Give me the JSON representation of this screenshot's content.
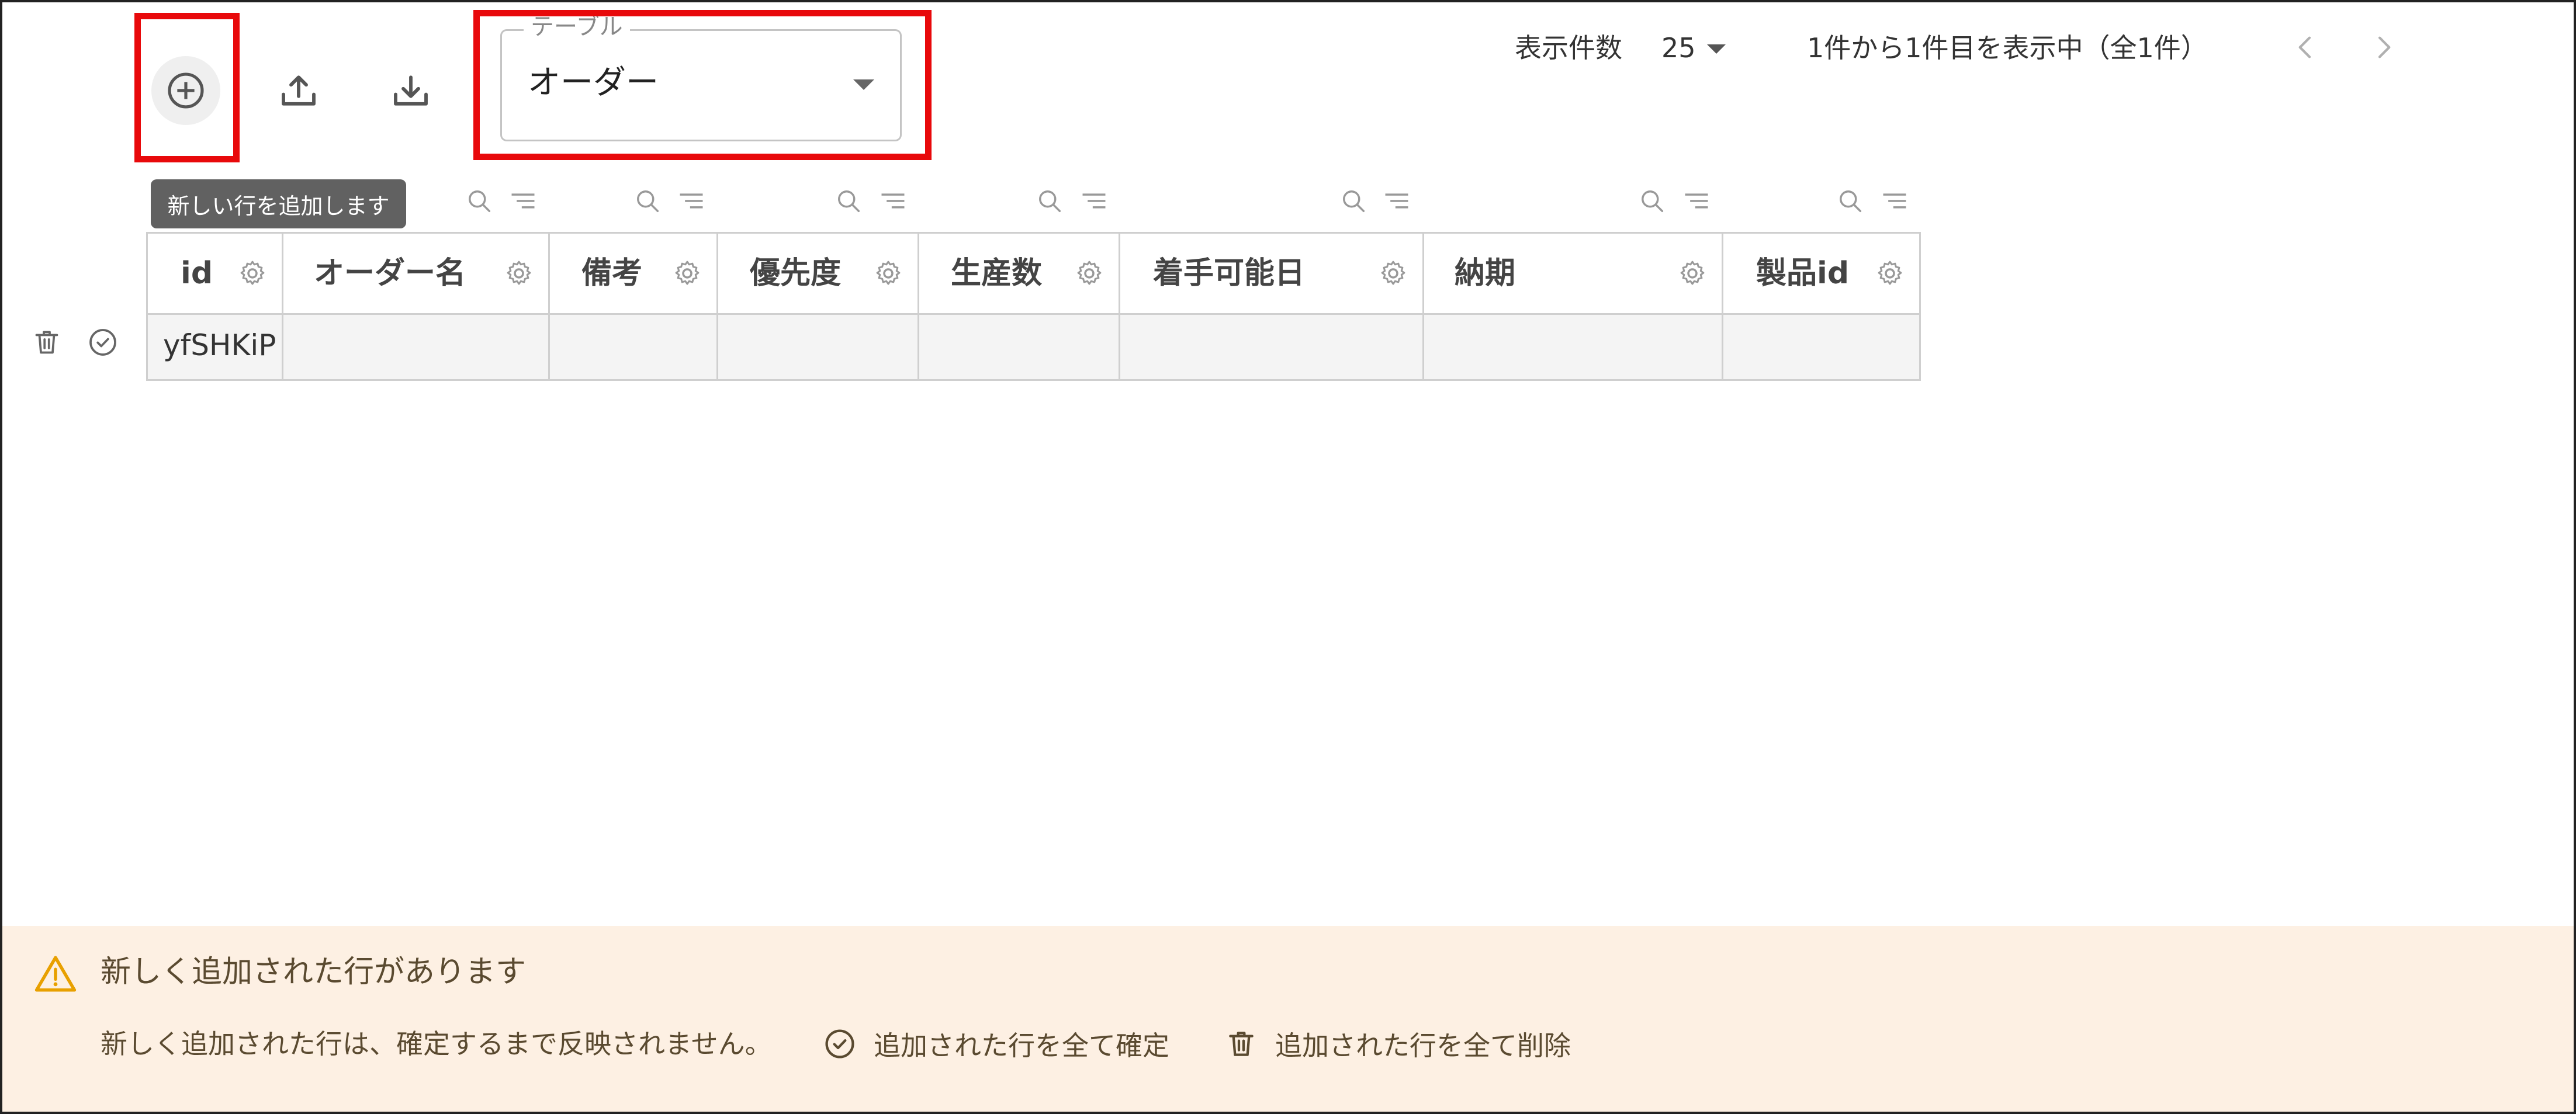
{
  "toolbar": {
    "add_icon": "add-circle-icon",
    "upload_icon": "upload-icon",
    "download_icon": "download-icon",
    "tooltip": "新しい行を追加します"
  },
  "table_select": {
    "legend": "テーブル",
    "value": "オーダー"
  },
  "pagination": {
    "rows_label": "表示件数",
    "rows_value": "25",
    "info": "1件から1件目を表示中（全1件）"
  },
  "columns": [
    {
      "label": "id"
    },
    {
      "label": "オーダー名"
    },
    {
      "label": "備考"
    },
    {
      "label": "優先度"
    },
    {
      "label": "生産数"
    },
    {
      "label": "着手可能日"
    },
    {
      "label": "納期"
    },
    {
      "label": "製品id"
    }
  ],
  "rows": [
    {
      "cells": [
        "yfSHKiP",
        "",
        "",
        "",
        "",
        "",
        "",
        ""
      ]
    }
  ],
  "banner": {
    "title": "新しく追加された行があります",
    "message": "新しく追加された行は、確定するまで反映されません。",
    "confirm_all": "追加された行を全て確定",
    "delete_all": "追加された行を全て削除"
  },
  "colors": {
    "highlight": "#e8090b",
    "banner_bg": "#fdf0e3",
    "warning": "#e8a000",
    "tooltip_bg": "#616161"
  }
}
